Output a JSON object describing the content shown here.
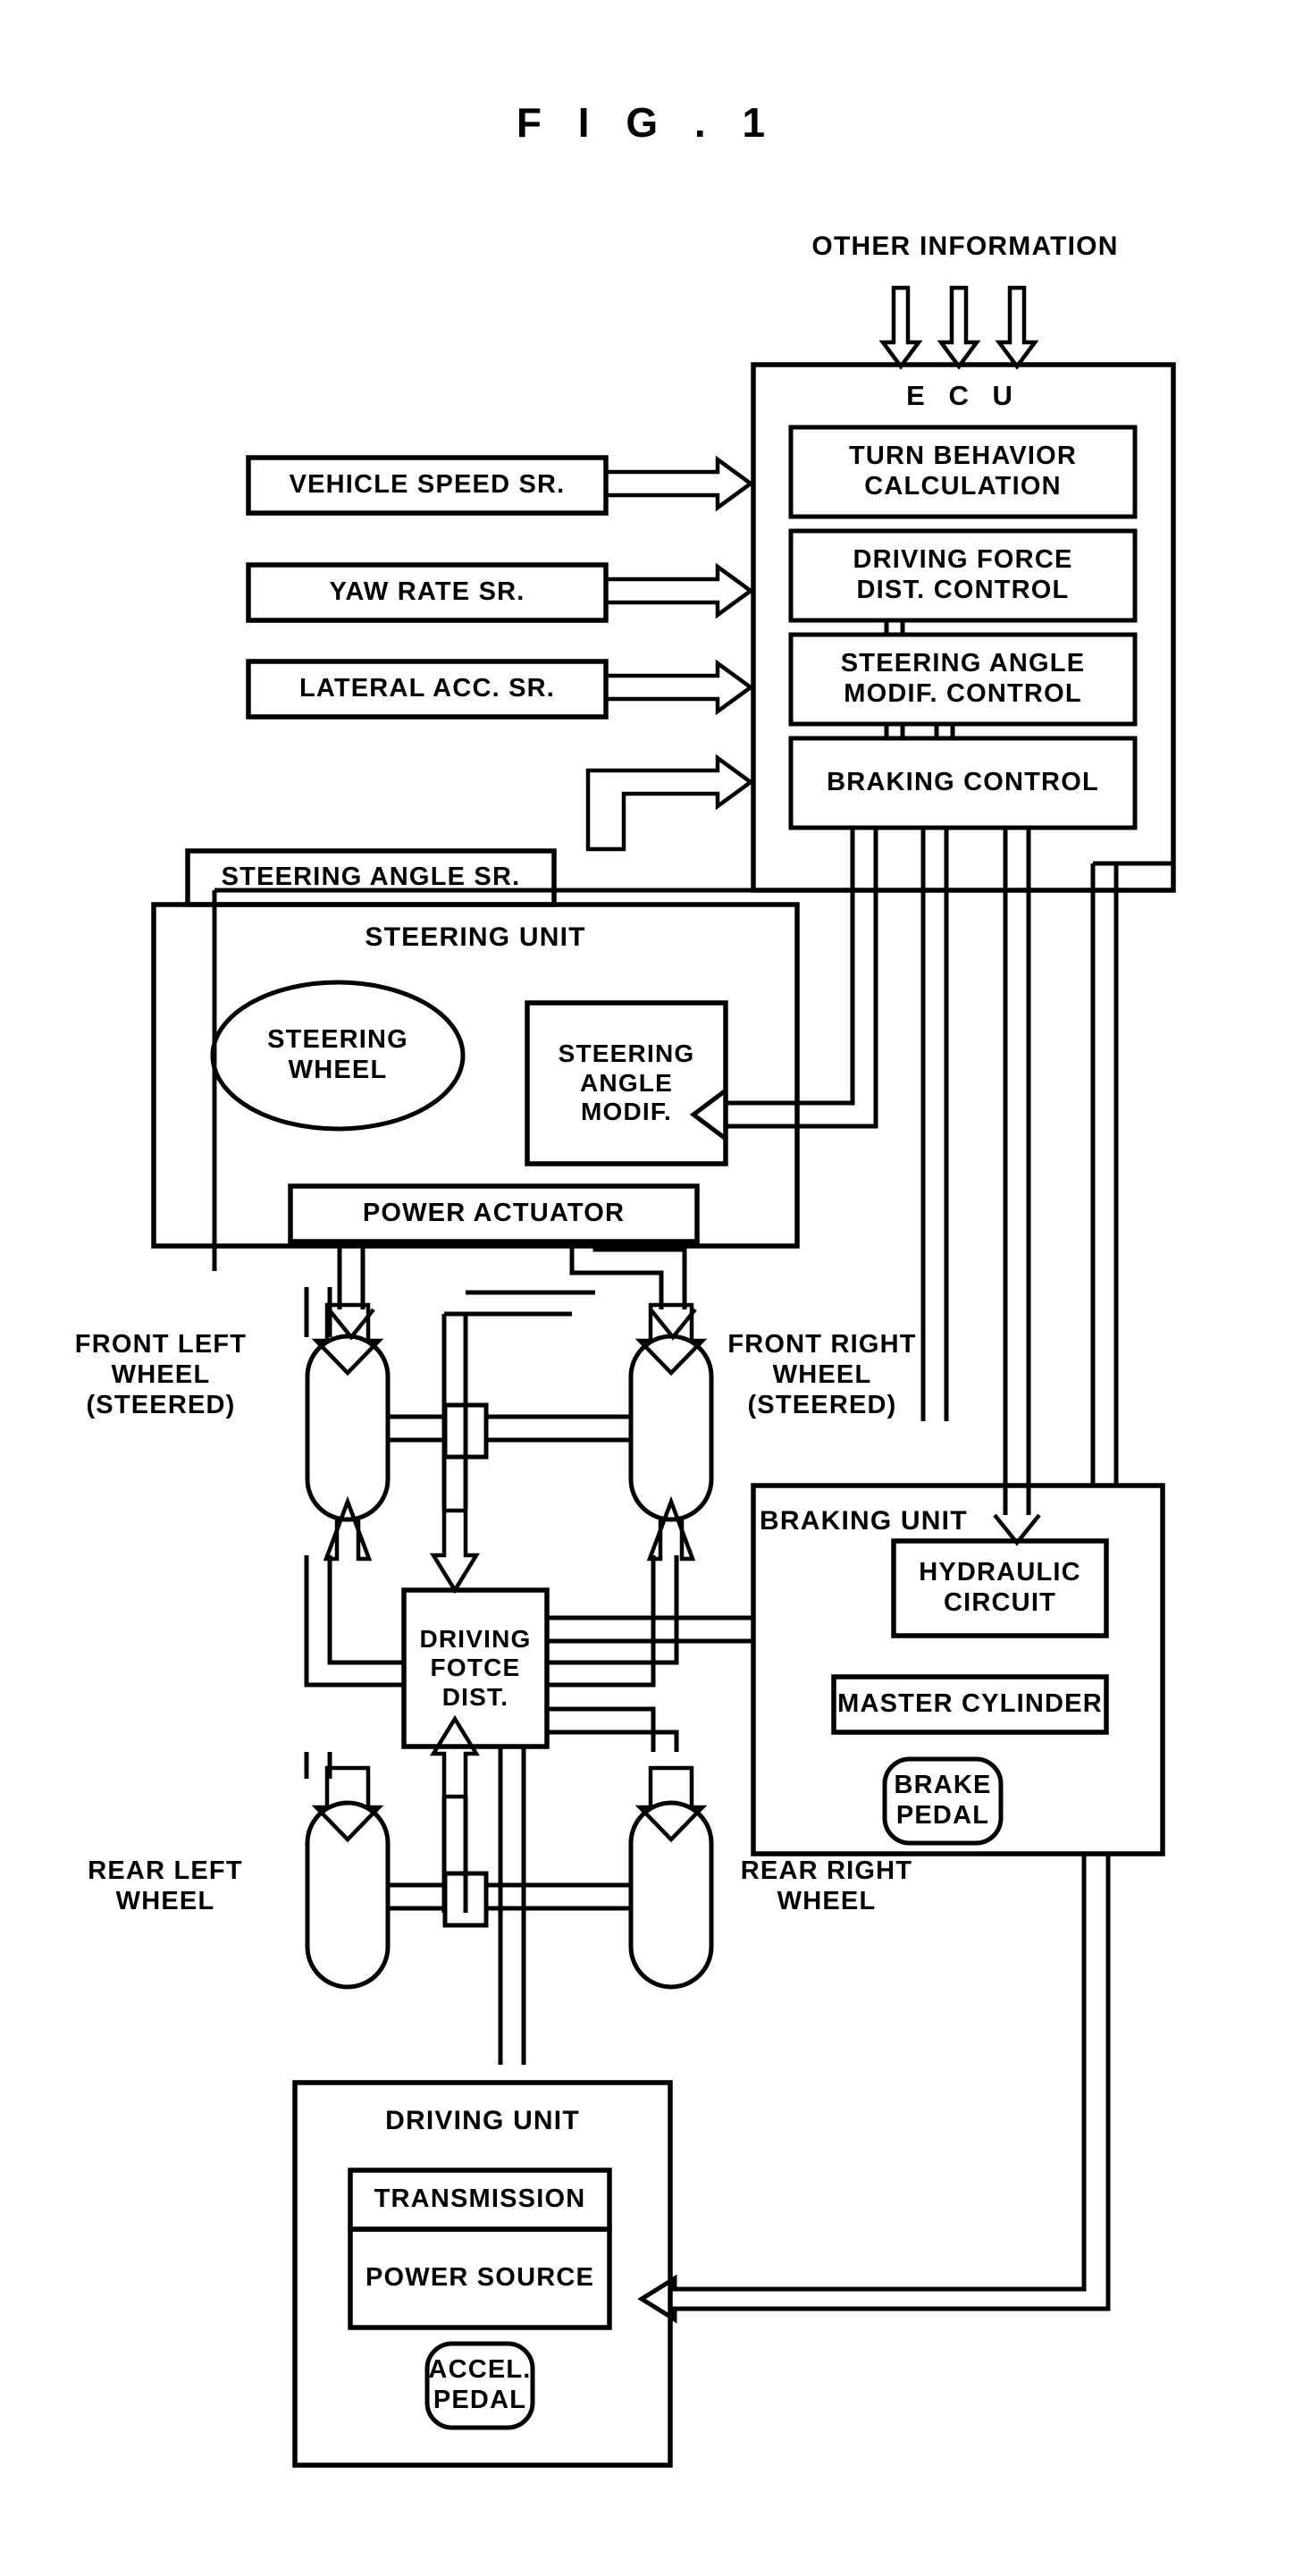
{
  "figure": {
    "title": "F I G .   1"
  },
  "top_annotation": {
    "label": "OTHER INFORMATION",
    "arrow_count": 3
  },
  "ecu": {
    "title": "E C U",
    "blocks": [
      {
        "id": "turn-behavior-calculation",
        "label": "TURN BEHAVIOR\nCALCULATION"
      },
      {
        "id": "driving-force-dist-control",
        "label": "DRIVING FORCE\nDIST.  CONTROL"
      },
      {
        "id": "steering-angle-modif-control",
        "label": "STEERING ANGLE\nMODIF.  CONTROL"
      },
      {
        "id": "braking-control",
        "label": "BRAKING CONTROL"
      }
    ]
  },
  "sensors": [
    {
      "id": "vehicle-speed-sensor",
      "label": "VEHICLE SPEED SR."
    },
    {
      "id": "yaw-rate-sensor",
      "label": "YAW RATE SR."
    },
    {
      "id": "lateral-acc-sensor",
      "label": "LATERAL ACC. SR."
    },
    {
      "id": "steering-angle-sensor",
      "label": "STEERING ANGLE SR."
    }
  ],
  "steering_unit": {
    "title": "STEERING UNIT",
    "steering_wheel": "STEERING\nWHEEL",
    "steering_angle_modif": "STEERING\nANGLE\nMODIF.",
    "power_actuator": "POWER ACTUATOR"
  },
  "wheels": [
    {
      "id": "front-left-wheel",
      "label": "FRONT LEFT\nWHEEL\n(STEERED)"
    },
    {
      "id": "front-right-wheel",
      "label": "FRONT RIGHT\nWHEEL\n(STEERED)"
    },
    {
      "id": "rear-left-wheel",
      "label": "REAR LEFT\nWHEEL"
    },
    {
      "id": "rear-right-wheel",
      "label": "REAR RIGHT\nWHEEL"
    }
  ],
  "driving_force_dist": {
    "label": "DRIVING\nFOTCE\nDIST."
  },
  "braking_unit": {
    "title": "BRAKING UNIT",
    "hydraulic_circuit": "HYDRAULIC\nCIRCUIT",
    "master_cylinder": "MASTER CYLINDER",
    "brake_pedal": "BRAKE\nPEDAL"
  },
  "driving_unit": {
    "title": "DRIVING UNIT",
    "transmission": "TRANSMISSION",
    "power_source": "POWER SOURCE",
    "accel_pedal": "ACCEL.\nPEDAL"
  },
  "colors": {
    "ink": "#000000",
    "paper": "#ffffff"
  }
}
